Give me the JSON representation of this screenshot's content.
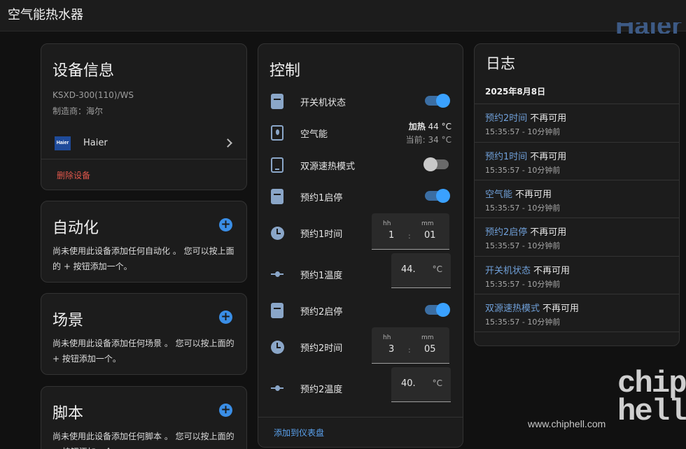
{
  "app": {
    "title": "空气能热水器",
    "brand_peek": "Haier"
  },
  "device_info": {
    "title": "设备信息",
    "model": "KSXD-300(110)/WS",
    "manufacturer": "制造商：海尔",
    "integration_logo_text": "Haier",
    "integration_name": "Haier",
    "delete_label": "删除设备"
  },
  "automation": {
    "title": "自动化",
    "description": "尚未使用此设备添加任何自动化 。 您可以按上面的 + 按钮添加一个。"
  },
  "scene": {
    "title": "场景",
    "description": "尚未使用此设备添加任何场景 。 您可以按上面的 + 按钮添加一个。"
  },
  "script": {
    "title": "脚本",
    "description": "尚未使用此设备添加任何脚本 。 您可以按上面的 + 按钮添加一个。"
  },
  "control": {
    "title": "控制",
    "power": {
      "label": "开关机状态",
      "on": true,
      "icon": "water-heater-icon"
    },
    "heat_pump": {
      "label": "空气能",
      "state_bold": "加热",
      "state_target": " 44 °C",
      "current": "当前: 34 °C",
      "icon": "water-boiler-icon"
    },
    "dual_source": {
      "label": "双源速热模式",
      "on": false,
      "icon": "tablet-icon"
    },
    "schedule1_switch": {
      "label": "预约1启停",
      "on": true,
      "icon": "water-heater-icon"
    },
    "schedule1_time": {
      "label": "预约1时间",
      "hh_label": "hh",
      "mm_label": "mm",
      "hh": "1",
      "mm": "01",
      "sep": ":",
      "icon": "clock-icon"
    },
    "schedule1_temp": {
      "label": "预约1温度",
      "value": "44.",
      "unit": "°C",
      "icon": "slider-icon"
    },
    "schedule2_switch": {
      "label": "预约2启停",
      "on": true,
      "icon": "water-heater-icon"
    },
    "schedule2_time": {
      "label": "预约2时间",
      "hh_label": "hh",
      "mm_label": "mm",
      "hh": "3",
      "mm": "05",
      "sep": ":",
      "icon": "clock-icon"
    },
    "schedule2_temp": {
      "label": "预约2温度",
      "value": "40.",
      "unit": "°C",
      "icon": "slider-icon"
    },
    "add_to_dashboard": "添加到仪表盘"
  },
  "log": {
    "title": "日志",
    "date": "2025年8月8日",
    "entries": [
      {
        "entity": "预约2时间",
        "state": "不再可用",
        "time": "15:35:57 - 10分钟前"
      },
      {
        "entity": "预约1时间",
        "state": "不再可用",
        "time": "15:35:57 - 10分钟前"
      },
      {
        "entity": "空气能",
        "state": "不再可用",
        "time": "15:35:57 - 10分钟前"
      },
      {
        "entity": "预约2启停",
        "state": "不再可用",
        "time": "15:35:57 - 10分钟前"
      },
      {
        "entity": "开关机状态",
        "state": "不再可用",
        "time": "15:35:57 - 10分钟前"
      },
      {
        "entity": "双源速热模式",
        "state": "不再可用",
        "time": "15:35:57 - 10分钟前"
      }
    ]
  },
  "watermark": {
    "url": "www.chiphell.com",
    "logo_top": "chip",
    "logo_bottom": "hell"
  },
  "colors": {
    "accent": "#3aa1ff",
    "link": "#5aa2ef",
    "danger": "#e0574b",
    "card": "#1c1c1c",
    "background": "#111111"
  }
}
